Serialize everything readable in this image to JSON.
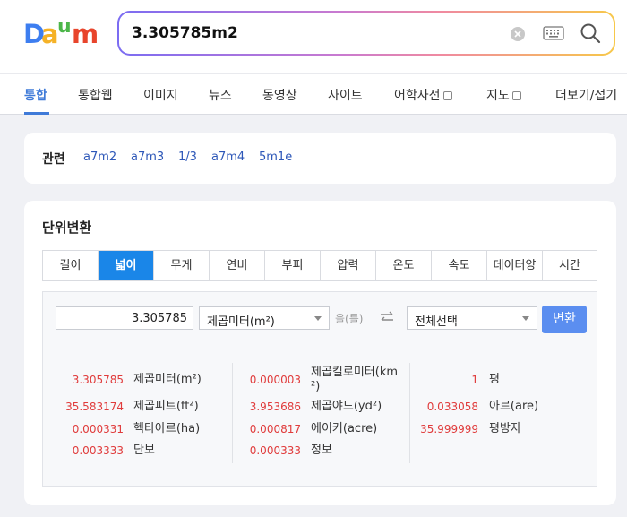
{
  "header": {
    "logo_text": "Daum",
    "search_value": "3.305785m2"
  },
  "nav": {
    "items": [
      {
        "label": "통합"
      },
      {
        "label": "통합웹"
      },
      {
        "label": "이미지"
      },
      {
        "label": "뉴스"
      },
      {
        "label": "동영상"
      },
      {
        "label": "사이트"
      },
      {
        "label": "어학사전"
      },
      {
        "label": "지도"
      },
      {
        "label": "더보기/접기"
      }
    ]
  },
  "related": {
    "title": "관련",
    "links": [
      "a7m2",
      "a7m3",
      "1/3",
      "a7m4",
      "5m1e"
    ]
  },
  "unit": {
    "title": "단위변환",
    "tabs": [
      "길이",
      "넓이",
      "무게",
      "연비",
      "부피",
      "압력",
      "온도",
      "속도",
      "데이터양",
      "시간"
    ],
    "active_tab": "넓이",
    "input_value": "3.305785",
    "from_unit": "제곱미터(m²)",
    "particle": "을(를)",
    "to_unit": "전체선택",
    "convert_label": "변환",
    "results": [
      {
        "value": "3.305785",
        "unit": "제곱미터(m²)"
      },
      {
        "value": "0.000003",
        "unit": "제곱킬로미터(km²)"
      },
      {
        "value": "1",
        "unit": "평"
      },
      {
        "value": "35.583174",
        "unit": "제곱피트(ft²)"
      },
      {
        "value": "3.953686",
        "unit": "제곱야드(yd²)"
      },
      {
        "value": "0.033058",
        "unit": "아르(are)"
      },
      {
        "value": "0.000331",
        "unit": "헥타아르(ha)"
      },
      {
        "value": "0.000817",
        "unit": "에이커(acre)"
      },
      {
        "value": "35.999999",
        "unit": "평방자"
      },
      {
        "value": "0.003333",
        "unit": "단보"
      },
      {
        "value": "0.000333",
        "unit": "정보"
      }
    ]
  },
  "colors": {
    "accent": "#3f7ad8",
    "active_tab": "#1a86e8",
    "convert_button": "#5b8ef0",
    "result_value": "#e03b3b"
  },
  "icons": {
    "clear": "clear-icon",
    "keyboard": "keyboard-icon",
    "search": "search-icon",
    "swap": "swap-icon",
    "external": "external-window-icon"
  }
}
